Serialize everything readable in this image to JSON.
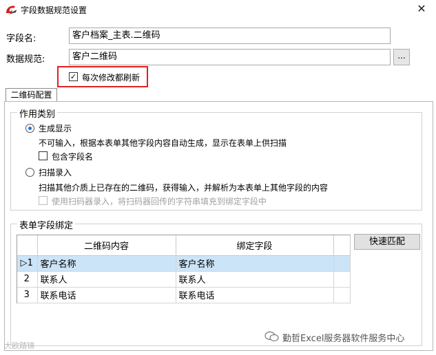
{
  "window": {
    "title": "字段数据规范设置",
    "close_glyph": "✕"
  },
  "form": {
    "field_name_label": "字段名:",
    "field_name_value": "客户档案_主表.二维码",
    "data_spec_label": "数据规范:",
    "data_spec_value": "客户二维码",
    "browse_label": "...",
    "refresh_checkbox_label": "每次修改都刷新",
    "refresh_checked": true
  },
  "tabs": [
    {
      "label": "二维码配置"
    }
  ],
  "usage": {
    "group_title": "作用类别",
    "generate_label": "生成显示",
    "generate_desc": "不可输入，根据本表单其他字段内容自动生成，显示在表单上供扫描",
    "include_field_name_label": "包含字段名",
    "scan_label": "扫描录入",
    "scan_desc": "扫描其他介质上已存在的二维码，获得输入，并解析为本表单上其他字段的内容",
    "scanner_label": "使用扫码器录入，将扫码器回传的字符串填充到绑定字段中"
  },
  "binding": {
    "group_title": "表单字段绑定",
    "quick_match_label": "快速匹配",
    "columns": [
      "二维码内容",
      "绑定字段"
    ],
    "rows": [
      {
        "index": "1",
        "content": "客户名称",
        "field": "客户名称"
      },
      {
        "index": "2",
        "content": "联系人",
        "field": "联系人"
      },
      {
        "index": "3",
        "content": "联系电话",
        "field": "联系电话"
      }
    ],
    "current_row_marker": "▷"
  },
  "watermarks": {
    "left": "大欧踏锦",
    "right": "勤哲Excel服务器软件服务中心"
  },
  "colors": {
    "highlight": "#e02020",
    "selection": "#cce4f7",
    "radio_accent": "#1e73d6"
  }
}
